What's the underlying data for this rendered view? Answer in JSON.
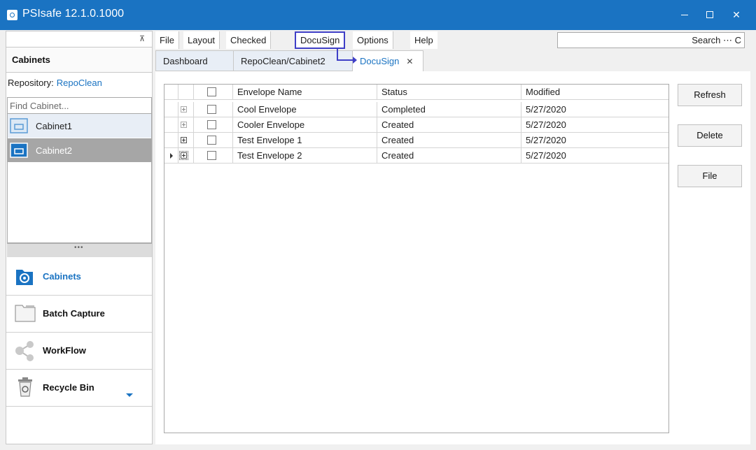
{
  "window": {
    "title": "PSIsafe 12.1.0.1000",
    "app_icon": "camera-icon"
  },
  "left_panel": {
    "header": "Cabinets",
    "repository_label": "Repository:",
    "repository_value": "RepoClean",
    "find_placeholder": "Find Cabinet...",
    "cabinets": [
      {
        "label": "Cabinet1",
        "icon": "cabinet-icon"
      },
      {
        "label": "Cabinet2",
        "icon": "cabinet-icon"
      }
    ],
    "nav": [
      {
        "label": "Cabinets",
        "icon": "cabinets-gear-icon"
      },
      {
        "label": "Batch Capture",
        "icon": "folder-icon"
      },
      {
        "label": "WorkFlow",
        "icon": "share-icon"
      },
      {
        "label": "Recycle Bin",
        "icon": "recycle-bin-icon"
      }
    ]
  },
  "menu": {
    "items": [
      "File",
      "Layout",
      "Checked Out",
      "DocuSign",
      "Options",
      "Help"
    ],
    "highlighted": "DocuSign"
  },
  "search": {
    "label": "Search ⋯ C"
  },
  "tabs": [
    {
      "label": "Dashboard"
    },
    {
      "label": "RepoClean/Cabinet2"
    },
    {
      "label": "DocuSign",
      "close": "✕"
    }
  ],
  "grid": {
    "columns": {
      "name": "Envelope Name",
      "status": "Status",
      "modified": "Modified"
    },
    "rows": [
      {
        "name": "Cool Envelope",
        "status": "Completed",
        "modified": "5/27/2020"
      },
      {
        "name": "Cooler Envelope",
        "status": "Created",
        "modified": "5/27/2020"
      },
      {
        "name": "Test Envelope 1",
        "status": "Created",
        "modified": "5/27/2020"
      },
      {
        "name": "Test Envelope 2",
        "status": "Created",
        "modified": "5/27/2020"
      }
    ]
  },
  "actions": {
    "refresh": "Refresh",
    "delete": "Delete",
    "file": "File"
  },
  "colors": {
    "accent": "#1a73c2",
    "highlight_box": "#3f3fc7",
    "selected_cabinet": "#a6a6a6"
  }
}
